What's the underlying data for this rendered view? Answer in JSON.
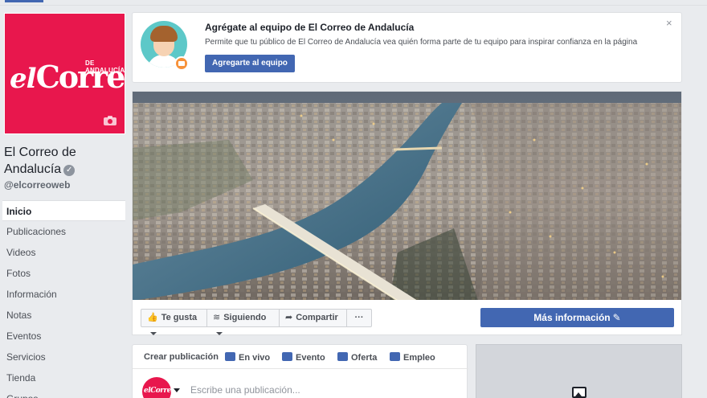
{
  "page": {
    "name": "El Correo de Andalucía",
    "handle": "@elcorreoweb",
    "logo": {
      "small": "DE ANDALUCÍA",
      "el": "el",
      "main": "Correo"
    }
  },
  "nav": [
    {
      "label": "Inicio",
      "active": true
    },
    {
      "label": "Publicaciones"
    },
    {
      "label": "Videos"
    },
    {
      "label": "Fotos"
    },
    {
      "label": "Información"
    },
    {
      "label": "Notas"
    },
    {
      "label": "Eventos"
    },
    {
      "label": "Servicios"
    },
    {
      "label": "Tienda"
    },
    {
      "label": "Grupos"
    }
  ],
  "promo": {
    "title": "Agrégate al equipo de El Correo de Andalucía",
    "text": "Permite que tu público de El Correo de Andalucía vea quién forma parte de tu equipo para inspirar confianza en la página",
    "button": "Agregarte al equipo",
    "close": "×"
  },
  "actions": {
    "like": "Te gusta",
    "follow": "Siguiendo",
    "share": "Compartir",
    "more": "···",
    "info": "Más información"
  },
  "composer": {
    "tabs": [
      "Crear publicación",
      "En vivo",
      "Evento",
      "Oferta",
      "Empleo"
    ],
    "placeholder": "Escribe una publicación...",
    "avatar_text": "elCorreo"
  },
  "colors": {
    "brand": "#e8174d",
    "facebook_blue": "#4267b2",
    "background": "#e9ebee"
  },
  "icons": [
    "camera-icon",
    "verified-icon",
    "close-icon",
    "thumbs-up-icon",
    "rss-icon",
    "share-icon",
    "more-icon",
    "pencil-icon",
    "video-icon",
    "calendar-icon",
    "offer-icon",
    "briefcase-icon",
    "add-photo-icon"
  ]
}
